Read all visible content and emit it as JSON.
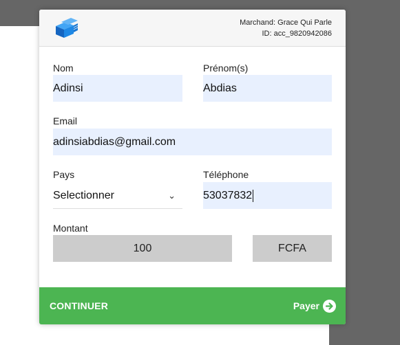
{
  "header": {
    "merchant_line": "Marchand: Grace Qui Parle",
    "id_line": "ID: acc_9820942086"
  },
  "form": {
    "nom": {
      "label": "Nom",
      "value": "Adinsi"
    },
    "prenom": {
      "label": "Prénom(s)",
      "value": "Abdias"
    },
    "email": {
      "label": "Email",
      "value": "adinsiabdias@gmail.com"
    },
    "pays": {
      "label": "Pays",
      "value": "Selectionner"
    },
    "telephone": {
      "label": "Téléphone",
      "value": "53037832"
    },
    "montant": {
      "label": "Montant",
      "value": "100",
      "currency": "FCFA"
    }
  },
  "footer": {
    "continue_label": "CONTINUER",
    "pay_label": "Payer"
  },
  "colors": {
    "accent_green": "#4cb552",
    "logo_blue": "#1e88e5",
    "input_fill": "#e8f0fe"
  }
}
